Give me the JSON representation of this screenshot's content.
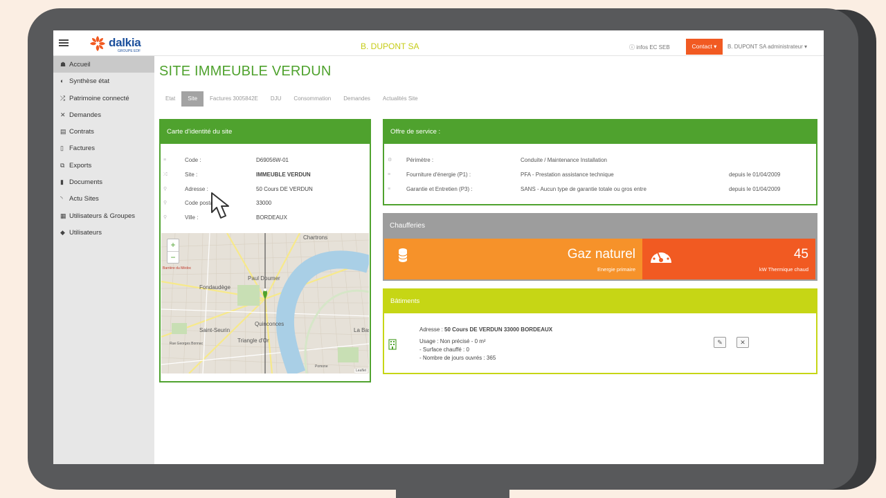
{
  "brand": {
    "name": "dalkia",
    "subtitle": "GROUPE EDF",
    "color": "#1b4f9c",
    "accent": "#f15a22"
  },
  "header": {
    "company": "B. DUPONT SA",
    "infos": "ⓘ infos EC SEB",
    "contact_label": "Contact ▾",
    "user_label": "B. DUPONT SA  administrateur ▾"
  },
  "sidebar": {
    "items": [
      {
        "label": "Accueil",
        "icon": "home-icon",
        "glyph": "☗"
      },
      {
        "label": "Synthèse état",
        "icon": "half-circle-icon",
        "glyph": "◐"
      },
      {
        "label": "Patrimoine connecté",
        "icon": "shuffle-icon",
        "glyph": "⤮"
      },
      {
        "label": "Demandes",
        "icon": "tools-icon",
        "glyph": "✕"
      },
      {
        "label": "Contrats",
        "icon": "document-icon",
        "glyph": "▤"
      },
      {
        "label": "Factures",
        "icon": "file-icon",
        "glyph": "▯"
      },
      {
        "label": "Exports",
        "icon": "copy-icon",
        "glyph": "⧉"
      },
      {
        "label": "Documents",
        "icon": "book-icon",
        "glyph": "▮"
      },
      {
        "label": "Actu Sites",
        "icon": "rss-icon",
        "glyph": "◝"
      },
      {
        "label": "Utilisateurs & Groupes",
        "icon": "users-icon",
        "glyph": "▦"
      },
      {
        "label": "Utilisateurs",
        "icon": "tag-icon",
        "glyph": "◆"
      }
    ]
  },
  "page": {
    "title": "SITE IMMEUBLE VERDUN"
  },
  "tabs": [
    "Etat",
    "Site",
    "Factures 3005842E",
    "DJU",
    "Consommation",
    "Demandes",
    "Actualités Site"
  ],
  "identity": {
    "title": "Carte d'identité du site",
    "rows": [
      {
        "label": "Code :",
        "value": "D69056W-01"
      },
      {
        "label": "Site :",
        "value": "IMMEUBLE VERDUN"
      },
      {
        "label": "Adresse :",
        "value": "50 Cours DE VERDUN"
      },
      {
        "label": "Code postal :",
        "value": "33000"
      },
      {
        "label": "Ville :",
        "value": "BORDEAUX"
      }
    ],
    "map": {
      "zoom_in": "+",
      "zoom_out": "−",
      "attribution": "Leaflet",
      "labels": [
        "Chartrons",
        "Paul Doumer",
        "Fondaudège",
        "Quinconces",
        "Saint-Seurin",
        "Triangle d'Or",
        "La Bastide",
        "Barrière du Médoc",
        "Rue Georges Bonnac",
        "Pomone"
      ]
    }
  },
  "offer": {
    "title": "Offre de service :",
    "rows": [
      {
        "label": "Périmètre :",
        "value": "Conduite / Maintenance Installation",
        "date": ""
      },
      {
        "label": "Fourniture d'énergie (P1) :",
        "value": "PFA - Prestation assistance technique",
        "date": "depuis le 01/04/2009"
      },
      {
        "label": "Garantie et Entretien (P3) :",
        "value": "SANS - Aucun type de garantie totale ou gros entre",
        "date": "depuis le 01/04/2009"
      }
    ]
  },
  "chaufferies": {
    "title": "Chaufferies",
    "energy_value": "Gaz naturel",
    "energy_label": "Energie primaire",
    "power_value": "45",
    "power_label": "kW Thermique chaud",
    "colors": {
      "energy": "#f6922a",
      "power": "#f15a22",
      "header": "#9d9d9d"
    }
  },
  "batiments": {
    "title": "Bâtiments",
    "address_label": "Adresse :",
    "address_value": "50 Cours DE VERDUN 33000 BORDEAUX",
    "usage": "Usage : Non précisé - 0 m²",
    "surface": "- Surface chauffé : 0",
    "jours": "- Nombre de jours ouvrés : 365"
  },
  "colors": {
    "green": "#4fa22e",
    "lime": "#c6d615",
    "orange": "#f15a22"
  }
}
